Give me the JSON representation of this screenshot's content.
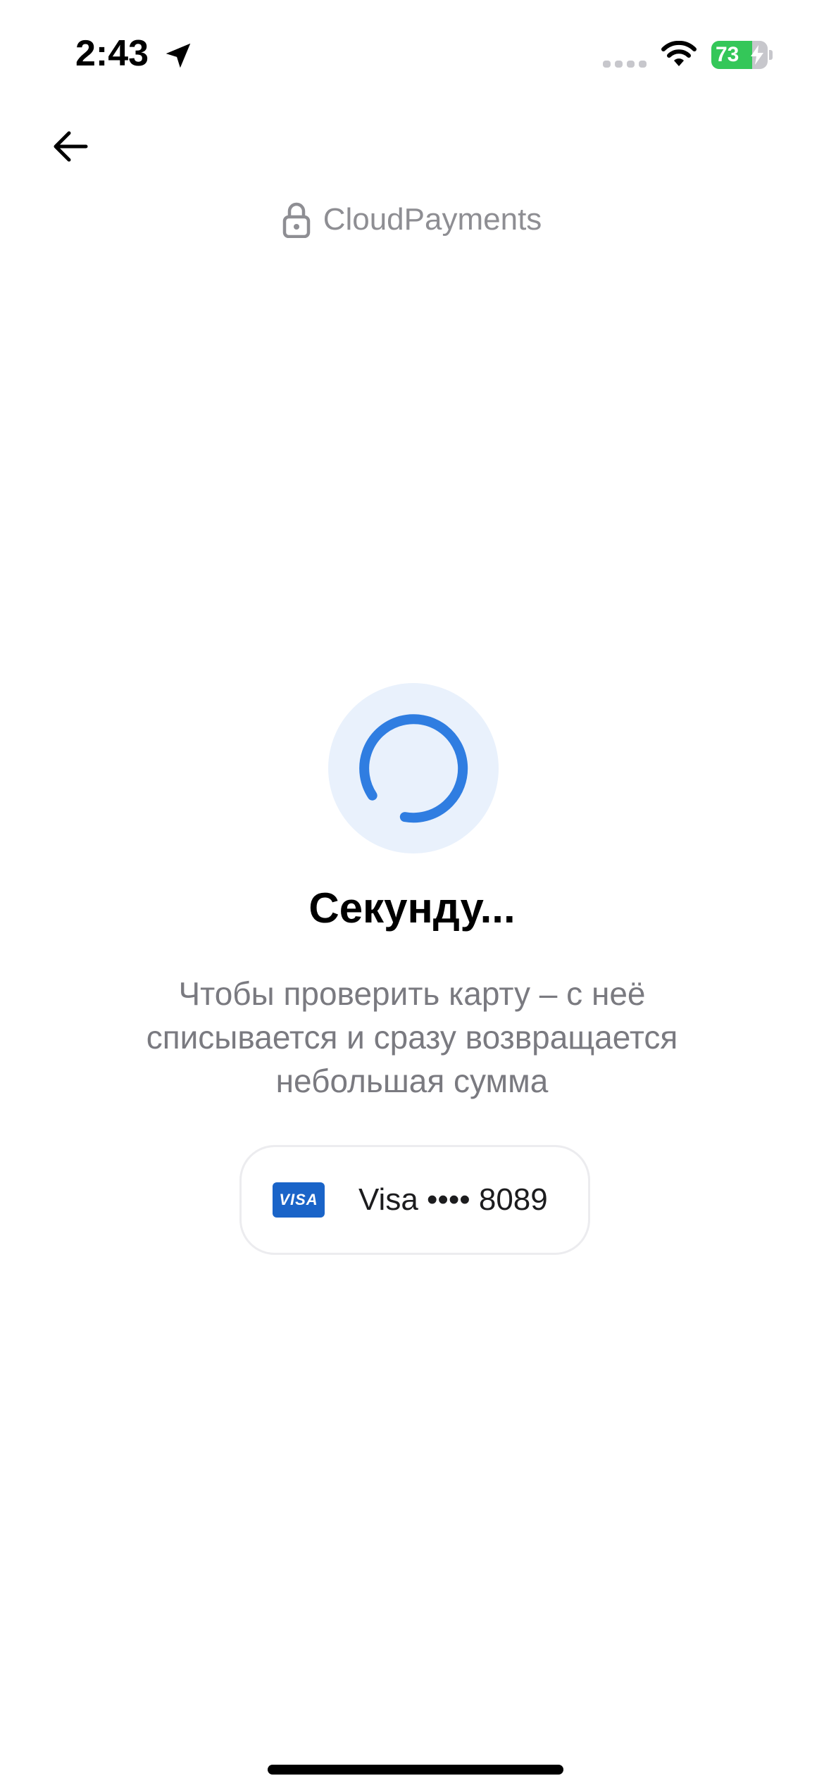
{
  "status_bar": {
    "time": "2:43",
    "battery_level": "73",
    "battery_fraction": 0.73,
    "icons": [
      "location-arrow-icon",
      "cellular-signal-icon",
      "wifi-icon",
      "battery-charging-icon"
    ]
  },
  "nav": {
    "back_icon": "arrow-left-icon"
  },
  "merchant": {
    "name": "CloudPayments",
    "icon": "lock-icon"
  },
  "main": {
    "title": "Секунду...",
    "description": "Чтобы проверить карту – с неё списывается и сразу возвращается небольшая сумма",
    "loader_icon": "spinner-icon"
  },
  "card": {
    "brand_logo": "VISA",
    "label": "Visa •••• 8089"
  },
  "colors": {
    "accent": "#2f7de1",
    "loader_bg": "#e9f1fc",
    "battery_green": "#34c759",
    "muted_text": "#8e8e93"
  }
}
